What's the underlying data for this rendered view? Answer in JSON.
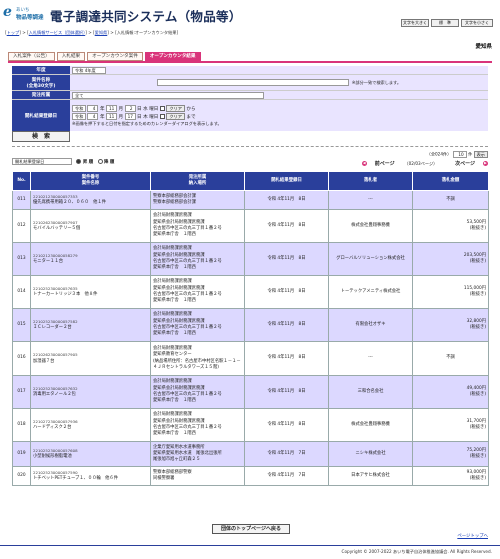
{
  "header": {
    "logo_mark": "e",
    "logo_line1": "あいち",
    "logo_line2": "物品等調達",
    "system_title": "電子調達共同システム（物品等）",
    "font_buttons": [
      "文字を大きく",
      "標　準",
      "文字を小さく"
    ]
  },
  "breadcrumb": {
    "top": "トップ",
    "sep1": " > ",
    "info_service": "入札情報サービス（団体選択）",
    "sep2": " > ",
    "aichi": "愛知県",
    "sep3": " > ",
    "current": "入札情報:オープンカウンタ結果",
    "open": "[",
    "close": "]"
  },
  "region": "愛知県",
  "tabs": [
    "入札案件（公告）",
    "入札結果",
    "オープンカウンタ案件",
    "オープンカウンタ結果"
  ],
  "form": {
    "year_label": "年度",
    "year_value": "令和 4年度",
    "name_label": "案件名称",
    "name_sub": "(全角30文字)",
    "name_value": "",
    "name_hint": "※部分一致で検索します。",
    "org_label": "発注所属",
    "org_value": "全て",
    "date_label": "開札結果登録日",
    "era": "令和",
    "from_year": "4",
    "from_month": "11",
    "from_day": "2",
    "to_year": "4",
    "to_month": "11",
    "to_day": "17",
    "year_unit": "年",
    "month_unit": "月",
    "day_unit": "日",
    "dow_unit": "曜日",
    "from_dow": "水",
    "to_dow": "木",
    "clear": "クリア",
    "from_word": "から",
    "to_word": "まで",
    "calendar_hint": "※画像を押下すると日付を指定するためのカレンダーダイアログを表示します。",
    "search_button": "検　索"
  },
  "sort": {
    "field": "開札結果登録日",
    "asc": "昇 順",
    "desc": "降 順"
  },
  "pager": {
    "total": "（全024件）",
    "per_page": "10",
    "per_unit": "件",
    "display": "表示",
    "page_info": "（02/03ページ）",
    "prev": "前ページ",
    "next": "次ページ"
  },
  "table": {
    "headers": {
      "no": "No.",
      "case_no": "案件番号",
      "case_name": "案件名称",
      "org1": "発注所属",
      "org2": "納入場所",
      "date": "開札結果登録日",
      "winner": "落札者",
      "amount": "落札金額"
    },
    "rows": [
      {
        "no": "011",
        "num": "221021230000057353",
        "name": "優先席携帯用箱２０、０６０　他１件",
        "org": [
          "警察本部総務部会計課",
          "警察本部総務部会計課"
        ],
        "date": "令和 4年11月　8日",
        "winner": "---",
        "amount": [
          "不調"
        ]
      },
      {
        "no": "012",
        "num": "221026230000057907",
        "name": "モバイルバッテリー５個",
        "org": [
          "会計局財務課庶務課",
          "愛知県会計局財務課庶務課",
          "名古屋市中区三の丸三丁目１番２号",
          "愛知県本庁舎　１階西"
        ],
        "date": "令和 4年11月　8日",
        "winner": "株式会社豊翔事務機",
        "amount": [
          "53,500円",
          "(税抜き)"
        ]
      },
      {
        "no": "013",
        "num": "221021230000058279",
        "name": "モニター１１台",
        "org": [
          "会計局財務課庶務課",
          "愛知県会計局財務課庶務課",
          "名古屋市中区三の丸三丁目１番２号",
          "愛知県本庁舎　１階西"
        ],
        "date": "令和 4年11月　8日",
        "winner": "グローバルソリューション株式会社",
        "amount": [
          "203,500円",
          "(税抜き)"
        ]
      },
      {
        "no": "014",
        "num": "221025230000057635",
        "name": "トナーカートリッジ３本　他８件",
        "org": [
          "会計局財務課庶務課",
          "愛知県会計局財務課庶務課",
          "名古屋市中区三の丸三丁目１番２号",
          "愛知県本庁舎　１階西"
        ],
        "date": "令和 4年11月　8日",
        "winner": "トーテックアメニティ株式会社",
        "amount": [
          "115,000円",
          "(税抜き)"
        ]
      },
      {
        "no": "015",
        "num": "221025230000057582",
        "name": "ＩＣレコーダー２台",
        "org": [
          "会計局財務課庶務課",
          "愛知県会計局財務課庶務課",
          "名古屋市中区三の丸三丁目１番２号",
          "愛知県本庁舎　１階西"
        ],
        "date": "令和 4年11月　8日",
        "winner": "有限会社オザキ",
        "amount": [
          "32,800円",
          "(税抜き)"
        ]
      },
      {
        "no": "016",
        "num": "221026230000057905",
        "name": "加湿器７台",
        "org": [
          "会計局財務課庶務課",
          "愛知県教育センター",
          "(納品場所住所：名古屋市中村区名駅１－１－４ＪＲセントラルタワーズ１５階)"
        ],
        "date": "令和 4年11月　8日",
        "winner": "---",
        "amount": [
          "不調"
        ]
      },
      {
        "no": "017",
        "num": "221025230000057632",
        "name": "消毒用エタノール２包",
        "org": [
          "会計局財務課庶務課",
          "愛知県会計局財務課庶務課",
          "名古屋市中区三の丸三丁目１番２号",
          "愛知県本庁舎　１階西"
        ],
        "date": "令和 4年11月　8日",
        "winner": "三和合名会社",
        "amount": [
          "49,400円",
          "(税抜き)"
        ]
      },
      {
        "no": "018",
        "num": "221027230000057936",
        "name": "ハードディスク２台",
        "org": [
          "会計局財務課庶務課",
          "愛知県会計局財務課庶務課",
          "名古屋市中区三の丸三丁目１番２号",
          "愛知県本庁舎　１階西"
        ],
        "date": "令和 4年11月　8日",
        "winner": "株式会社豊翔事務機",
        "amount": [
          "31,700円",
          "(税抜き)"
        ]
      },
      {
        "no": "019",
        "num": "221025230000057608",
        "name": "小型耐候形樹脂電池",
        "org": [
          "企業庁愛知用水水道事務所",
          "愛知県愛知用水水道　尾張北出張所",
          "尾張旭市旭ヶ丘町森２５"
        ],
        "date": "令和 4年11月　7日",
        "winner": "ニシキ株式会社",
        "amount": [
          "75,200円",
          "(税抜き)"
        ]
      },
      {
        "no": "020",
        "num": "221025230000057590",
        "name": "トチベットPETチューブ１、００輪　他６件",
        "org": [
          "警察本部総務部警察",
          "同検警察署"
        ],
        "date": "令和 4年11月　7日",
        "winner": "日本アサヒ株式会社",
        "amount": [
          "93,000円",
          "(税抜き)"
        ]
      }
    ]
  },
  "bottom": {
    "top_button": "団体のトップページへ戻る",
    "page_top": "ページトップへ",
    "copyright": "Copyright © 2007-2022 あいち電子自治体推進協議会. All Rights Reserved."
  }
}
